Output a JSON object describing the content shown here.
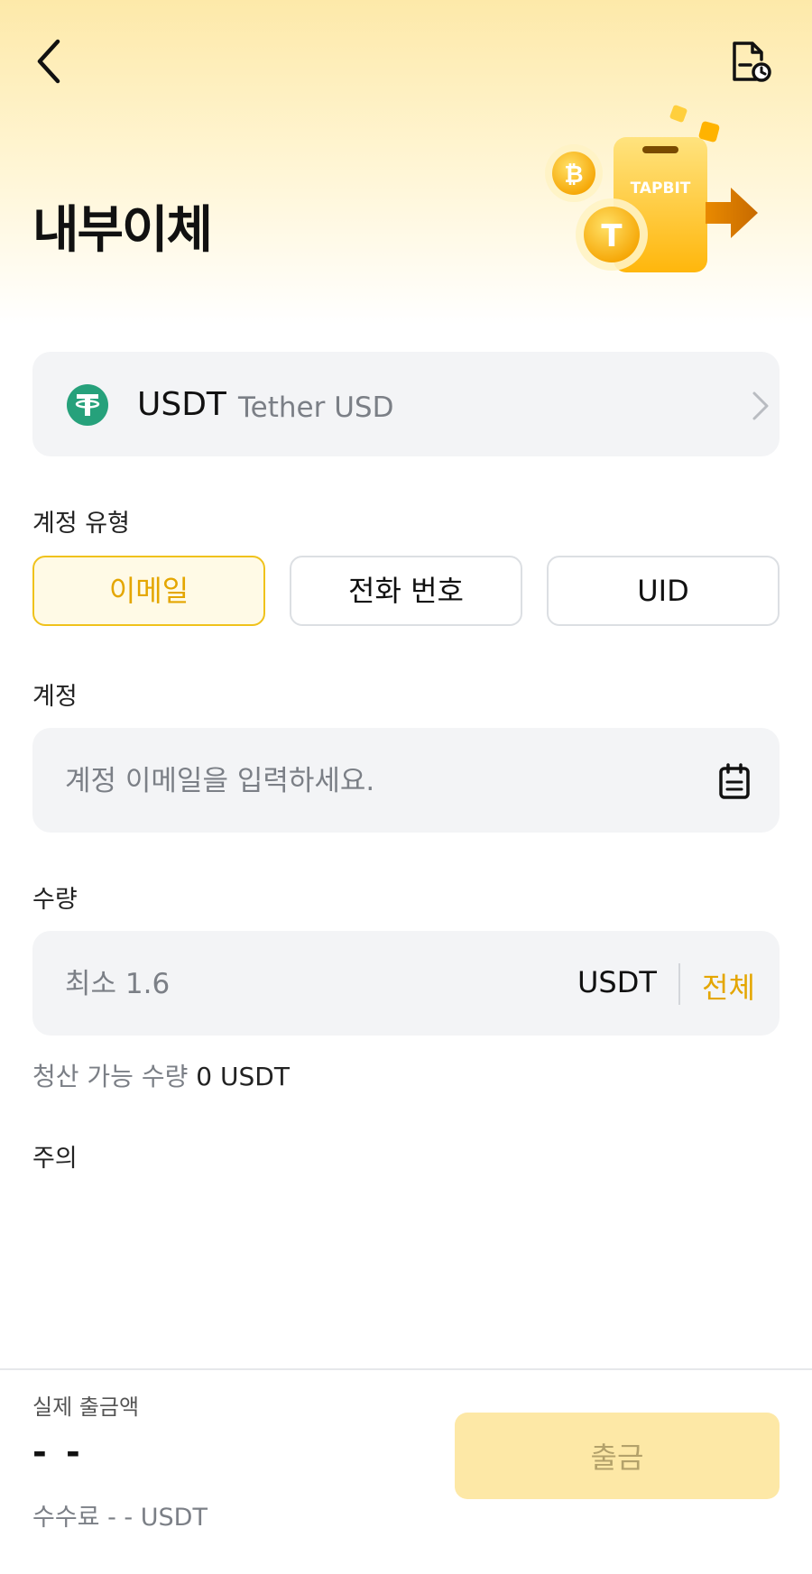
{
  "header": {
    "title": "내부이체",
    "back_icon": "chevron-left-icon",
    "history_icon": "document-clock-icon",
    "illustration_text": "TAPBIT"
  },
  "coin": {
    "symbol": "USDT",
    "name": "Tether USD",
    "icon": "tether-icon",
    "color": "#26a17b"
  },
  "account_type": {
    "label": "계정 유형",
    "options": [
      "이메일",
      "전화 번호",
      "UID"
    ],
    "selected": "이메일"
  },
  "account": {
    "label": "계정",
    "placeholder": "계정 이메일을 입력하세요.",
    "value": "",
    "paste_icon": "clipboard-icon"
  },
  "amount": {
    "label": "수량",
    "placeholder": "최소 1.6",
    "value": "",
    "unit": "USDT",
    "max_label": "전체"
  },
  "available": {
    "label": "청산 가능 수량",
    "value": "0 USDT"
  },
  "notice": {
    "label": "주의"
  },
  "footer": {
    "receive_label": "실제 출금액",
    "receive_value": "- -",
    "fee_text": "수수료 - -  USDT",
    "withdraw_label": "출금"
  },
  "colors": {
    "accent": "#f0c21b",
    "accent_text": "#e4a600",
    "button_disabled_bg": "#fde8a6"
  }
}
